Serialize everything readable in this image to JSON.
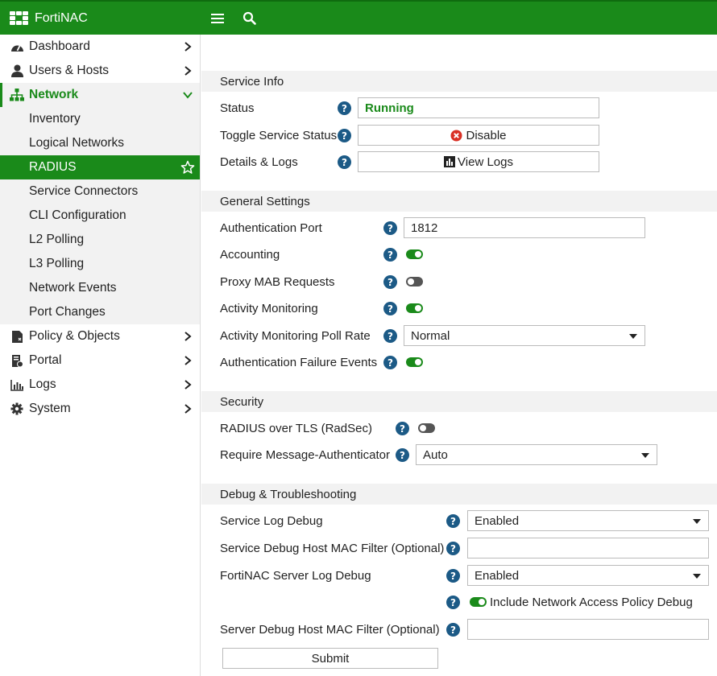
{
  "app": {
    "title": "FortiNAC",
    "brand_color": "#1a8a1a",
    "menu_icon": "hamburger-icon",
    "search_icon": "search-icon"
  },
  "sidebar": {
    "items": [
      {
        "label": "Dashboard",
        "icon": "dashboard-icon"
      },
      {
        "label": "Users & Hosts",
        "icon": "user-icon"
      },
      {
        "label": "Network",
        "icon": "network-icon",
        "expanded": true
      },
      {
        "label": "Policy & Objects",
        "icon": "policy-icon"
      },
      {
        "label": "Portal",
        "icon": "portal-icon"
      },
      {
        "label": "Logs",
        "icon": "logs-icon"
      },
      {
        "label": "System",
        "icon": "gear-icon"
      }
    ],
    "network_children": [
      "Inventory",
      "Logical Networks",
      "RADIUS",
      "Service Connectors",
      "CLI Configuration",
      "L2 Polling",
      "L3 Polling",
      "Network Events",
      "Port Changes"
    ],
    "active_child": "RADIUS"
  },
  "service_info": {
    "heading": "Service Info",
    "status_label": "Status",
    "status_value": "Running",
    "toggle_label": "Toggle Service Status",
    "toggle_button": "Disable",
    "details_label": "Details & Logs",
    "details_button": "View Logs"
  },
  "general": {
    "heading": "General Settings",
    "auth_port_label": "Authentication Port",
    "auth_port_value": "1812",
    "accounting_label": "Accounting",
    "accounting_on": true,
    "proxy_mab_label": "Proxy MAB Requests",
    "proxy_mab_on": false,
    "activity_label": "Activity Monitoring",
    "activity_on": true,
    "poll_rate_label": "Activity Monitoring Poll Rate",
    "poll_rate_value": "Normal",
    "auth_fail_label": "Authentication Failure Events",
    "auth_fail_on": true
  },
  "security": {
    "heading": "Security",
    "radsec_label": "RADIUS over TLS (RadSec)",
    "radsec_on": false,
    "msg_auth_label": "Require Message-Authenticator",
    "msg_auth_value": "Auto"
  },
  "debug": {
    "heading": "Debug & Troubleshooting",
    "service_log_label": "Service Log Debug",
    "service_log_value": "Enabled",
    "service_mac_label": "Service Debug Host MAC Filter (Optional)",
    "service_mac_value": "",
    "server_log_label": "FortiNAC Server Log Debug",
    "server_log_value": "Enabled",
    "include_policy_label": "Include Network Access Policy Debug",
    "include_policy_on": true,
    "server_mac_label": "Server Debug Host MAC Filter (Optional)",
    "server_mac_value": ""
  },
  "submit_label": "Submit"
}
